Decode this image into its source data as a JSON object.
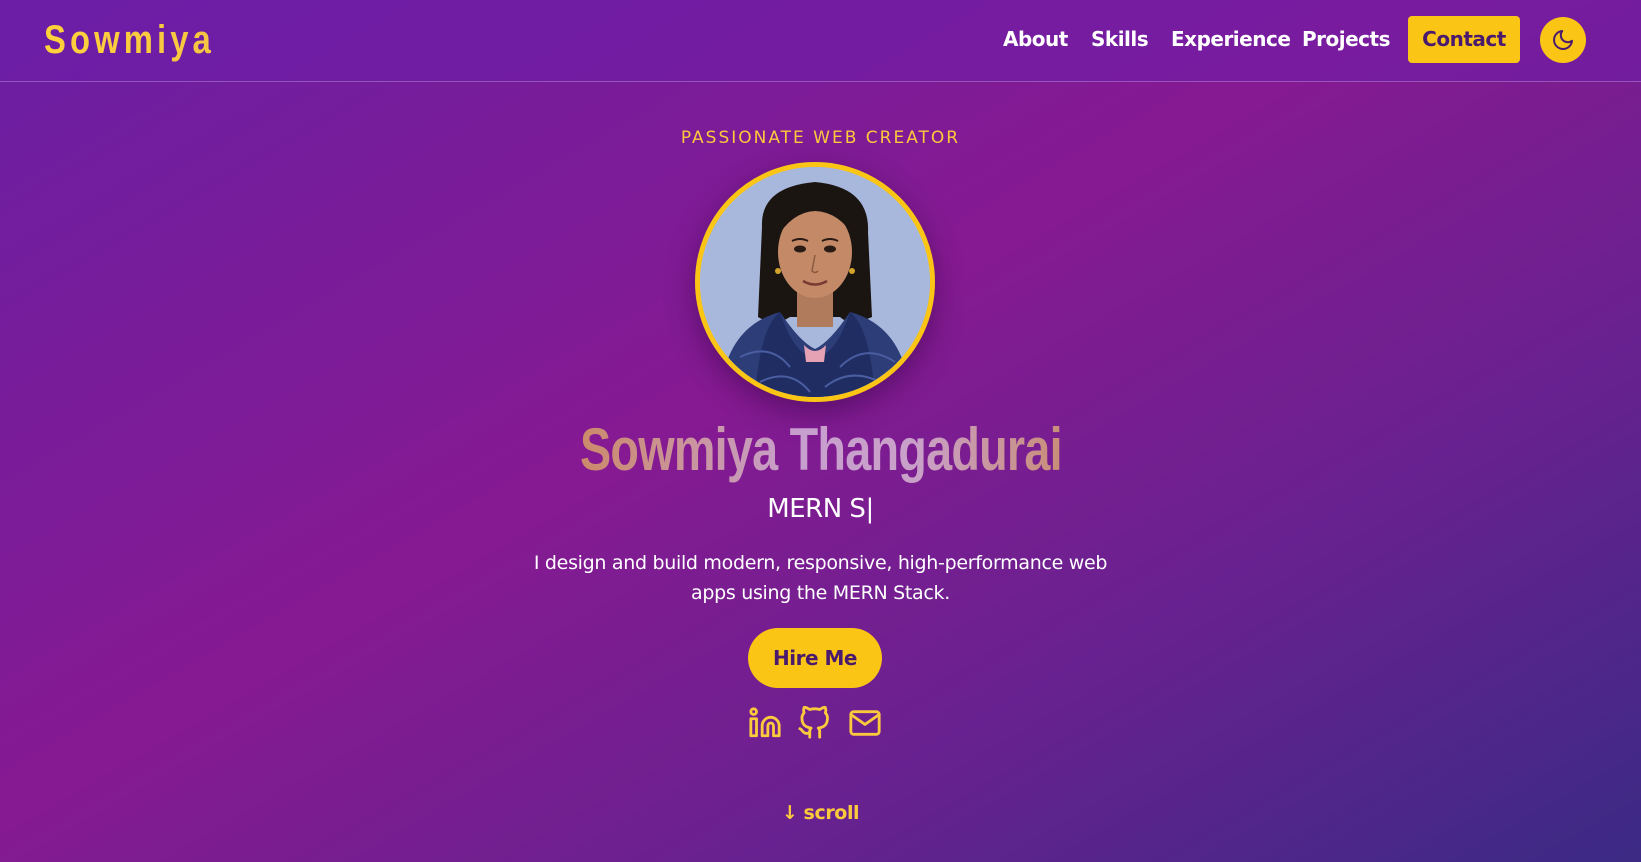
{
  "header": {
    "logo": "Sowmiya",
    "nav": [
      "About",
      "Skills",
      "Experience",
      "Projects"
    ],
    "contact_label": "Contact",
    "theme_toggle_icon": "moon-icon"
  },
  "hero": {
    "tagline": "PASSIONATE WEB CREATOR",
    "name": "Sowmiya Thangadurai",
    "role": "MERN S|",
    "bio": "I design and build modern, responsive, high-performance web apps using the MERN Stack.",
    "cta_label": "Hire Me",
    "socials": [
      "linkedin-icon",
      "github-icon",
      "mail-icon"
    ],
    "scroll_label": "↓ scroll"
  },
  "colors": {
    "accent": "#fac515",
    "background_start": "#6a1fa3",
    "background_end": "#3b2a85",
    "button_text": "#4a1a6e"
  }
}
